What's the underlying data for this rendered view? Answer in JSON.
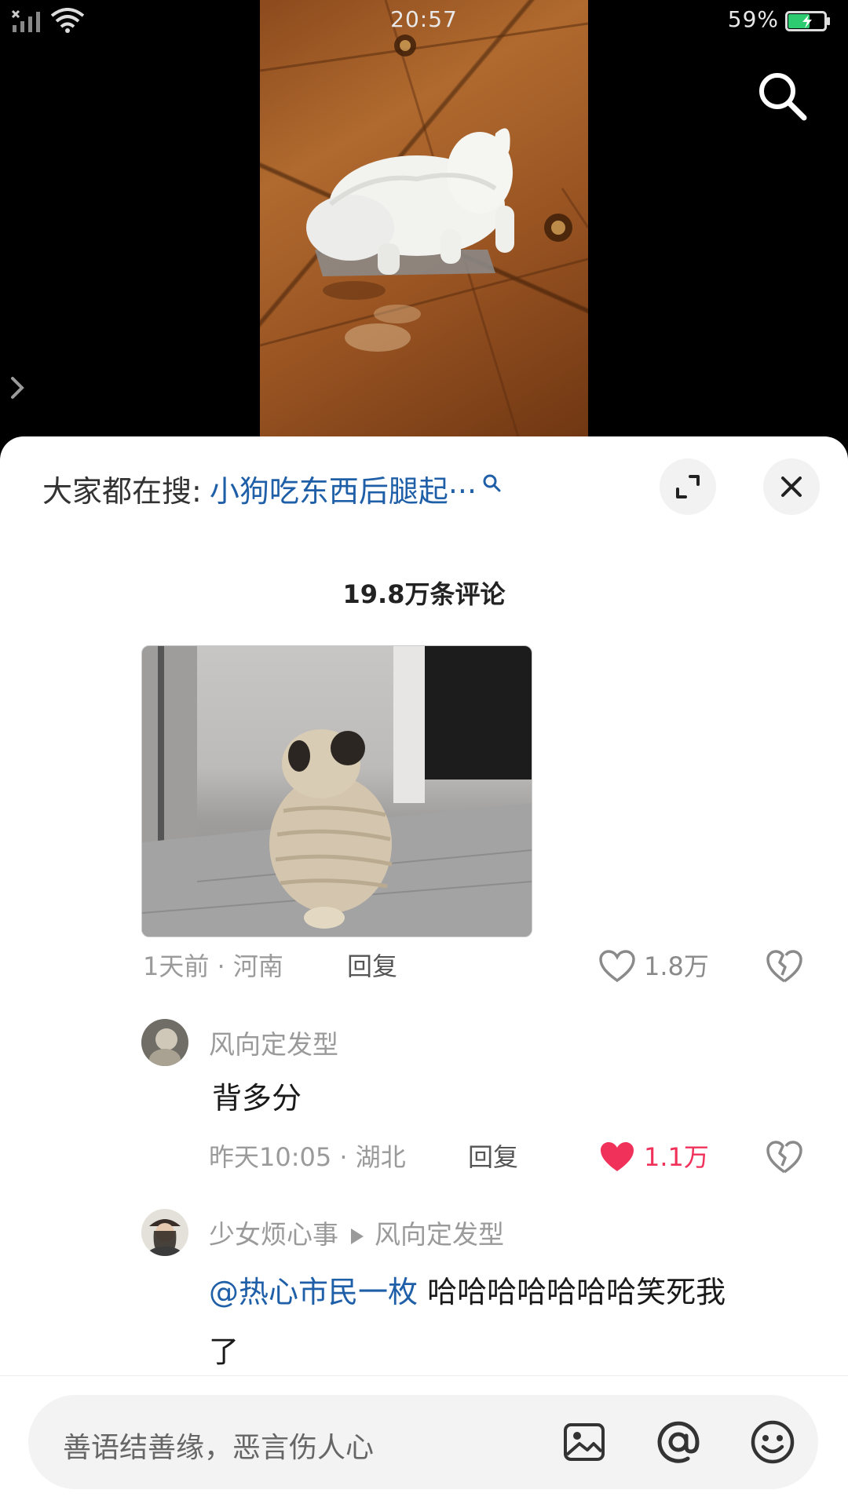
{
  "status_bar": {
    "time": "20:57",
    "battery_percent": "59%",
    "battery_level": 0.59,
    "battery_color": "#2ecc71"
  },
  "video": {
    "search_icon": "search-icon",
    "side_arrow_icon": "chevron-right-icon"
  },
  "sheet": {
    "hot_search_prefix": "大家都在搜:",
    "hot_search_query": "小狗吃东西后腿起···",
    "expand_icon": "expand-icon",
    "close_icon": "close-icon",
    "comment_count": "19.8万条评论"
  },
  "comments": [
    {
      "time": "1天前",
      "location": "河南",
      "meta": "1天前 · 河南",
      "reply_label": "回复",
      "likes": "1.8万",
      "liked": false
    },
    {
      "username": "风向定发型",
      "text": "背多分",
      "meta": "昨天10:05 · 湖北",
      "reply_label": "回复",
      "likes": "1.1万",
      "liked": true
    },
    {
      "username": "少女烦心事",
      "reply_to": "风向定发型",
      "mention": "@热心市民一枚",
      "text_line1": " 哈哈哈哈哈哈哈笑死我",
      "text_line2": "了"
    }
  ],
  "input_bar": {
    "placeholder": "善语结善缘，恶言伤人心",
    "icons": [
      "image-icon",
      "at-icon",
      "emoji-icon"
    ]
  },
  "colors": {
    "accent_blue": "#1f5fa8",
    "like_red": "#f0315a"
  }
}
